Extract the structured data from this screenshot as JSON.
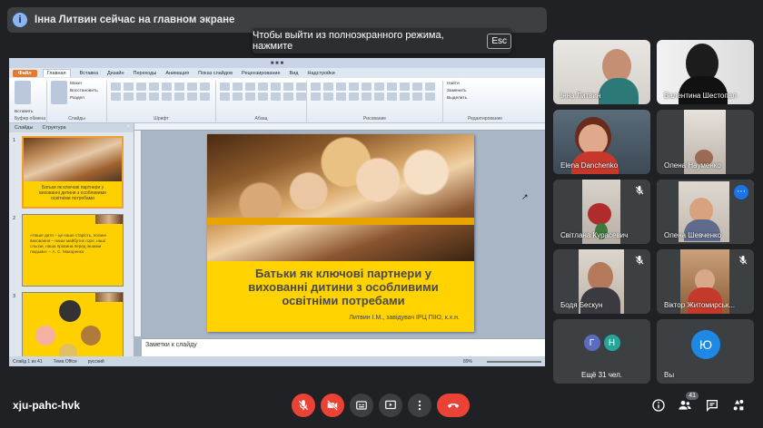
{
  "presenter_banner": {
    "icon": "info-icon",
    "text": "Інна Литвин сейчас на главном экране"
  },
  "fullscreen_toast": {
    "text": "Чтобы выйти из полноэкранного режима, нажмите",
    "key": "Esc"
  },
  "ppt": {
    "file_tab": "Файл",
    "tabs": [
      "Главная",
      "Вставка",
      "Дизайн",
      "Переходы",
      "Анимация",
      "Показ слайдов",
      "Рецензирование",
      "Вид",
      "Надстройки"
    ],
    "ribbon_groups": [
      "Буфер обмена",
      "Слайды",
      "Шрифт",
      "Абзац",
      "Рисование",
      "Редактирование"
    ],
    "ribbon_items": {
      "layout": "Макет",
      "restore": "Восстановить",
      "section": "Раздел",
      "create": "Создать слайд",
      "paste": "Вставить",
      "find": "Найти",
      "replace": "Заменить",
      "select": "Выделить"
    },
    "panel_tabs": [
      "Слайды",
      "Структура"
    ],
    "thumbs": [
      {
        "num": "1",
        "text": "Батьки як ключові партнери у вихованні дитини з особливими освітніми потребами"
      },
      {
        "num": "2",
        "text": "«Наше дитя – це наше старість, погане виховання – наше майбутнє горе, наші сльози, наша провина перед іншими людьми»   – А. С. Макаренко"
      },
      {
        "num": "3",
        "text": ""
      }
    ],
    "slide": {
      "title": "Батьки як ключові партнери у вихованні дитини з особливими освітніми потребами",
      "author": "Литвин І.М., завідувач ІРЦ ПІЮ, к.х.н."
    },
    "notes_placeholder": "Заметки к слайду",
    "status": {
      "slide_info": "Слайд 1 из 41",
      "theme": "Тема Office",
      "language": "русский",
      "zoom": "89%"
    }
  },
  "participants": [
    {
      "name": "Інна Литвин",
      "muted": false,
      "active": false
    },
    {
      "name": "Валентина Шестопал",
      "muted": false,
      "active": false
    },
    {
      "name": "Elena Danchenko",
      "muted": false,
      "active": false
    },
    {
      "name": "Олена Науменко",
      "muted": false,
      "active": false
    },
    {
      "name": "Світлана Курасевич",
      "muted": true,
      "active": false
    },
    {
      "name": "Олена Шевченко",
      "muted": false,
      "active": true
    },
    {
      "name": "Бодя Бескун",
      "muted": true,
      "active": false
    },
    {
      "name": "Віктор Житомирськ...",
      "muted": true,
      "active": false
    }
  ],
  "others": {
    "label": "Ещё 31 чел.",
    "initials": [
      "Г",
      "Н"
    ]
  },
  "self_tile": {
    "label": "Вы",
    "initial": "Ю"
  },
  "meeting_code": "xju-pahc-hvk",
  "people_count": "41",
  "colors": {
    "background": "#202124",
    "tile": "#3c4043",
    "red": "#ea4335",
    "blue": "#1a73e8",
    "slide_yellow": "#ffd200"
  }
}
